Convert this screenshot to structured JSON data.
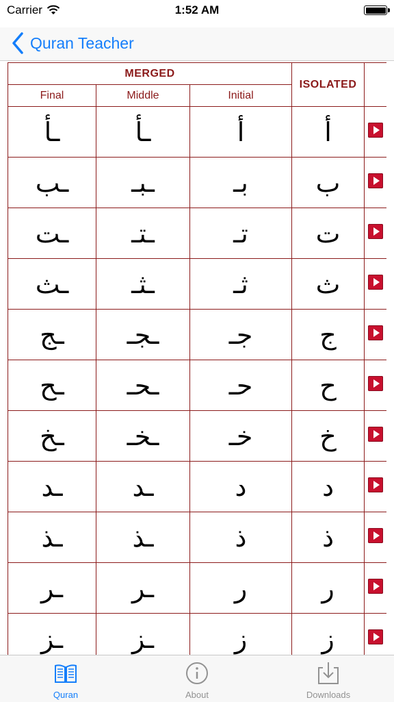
{
  "status": {
    "carrier": "Carrier",
    "time": "1:52 AM"
  },
  "nav": {
    "back_label": "Quran Teacher"
  },
  "table": {
    "merged_label": "MERGED",
    "isolated_label": "ISOLATED",
    "sub_headers": {
      "final": "Final",
      "middle": "Middle",
      "initial": "Initial"
    },
    "rows": [
      {
        "final": "ـأ",
        "middle": "ـأ",
        "initial": "أ",
        "isolated": "أ"
      },
      {
        "final": "ـب",
        "middle": "ـبـ",
        "initial": "بـ",
        "isolated": "ب"
      },
      {
        "final": "ـت",
        "middle": "ـتـ",
        "initial": "تـ",
        "isolated": "ت"
      },
      {
        "final": "ـث",
        "middle": "ـثـ",
        "initial": "ثـ",
        "isolated": "ث"
      },
      {
        "final": "ـج",
        "middle": "ـجـ",
        "initial": "جـ",
        "isolated": "ج"
      },
      {
        "final": "ـح",
        "middle": "ـحـ",
        "initial": "حـ",
        "isolated": "ح"
      },
      {
        "final": "ـخ",
        "middle": "ـخـ",
        "initial": "خـ",
        "isolated": "خ"
      },
      {
        "final": "ـد",
        "middle": "ـد",
        "initial": "د",
        "isolated": "د"
      },
      {
        "final": "ـذ",
        "middle": "ـذ",
        "initial": "ذ",
        "isolated": "ذ"
      },
      {
        "final": "ـر",
        "middle": "ـر",
        "initial": "ر",
        "isolated": "ر"
      },
      {
        "final": "ـز",
        "middle": "ـز",
        "initial": "ز",
        "isolated": "ز"
      }
    ]
  },
  "tabs": [
    {
      "label": "Quran",
      "icon": "book-icon",
      "active": true
    },
    {
      "label": "About",
      "icon": "info-icon",
      "active": false
    },
    {
      "label": "Downloads",
      "icon": "download-icon",
      "active": false
    }
  ],
  "colors": {
    "accent": "#147efb",
    "table_border": "#8b1a1a",
    "play_button": "#c8102e"
  }
}
